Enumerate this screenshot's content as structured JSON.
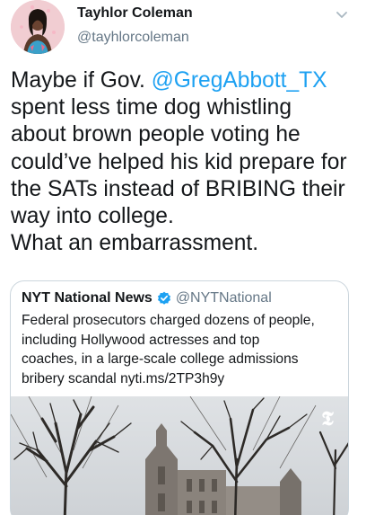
{
  "author": {
    "name": "Tayhlor Coleman",
    "handle": "@tayhlorcoleman"
  },
  "tweet": {
    "lines": [
      {
        "pre": "Maybe if Gov. ",
        "mention": "@GregAbbott_TX",
        "post": ""
      },
      {
        "text": "spent less time dog whistling"
      },
      {
        "text": "about brown people voting he"
      },
      {
        "text": "could’ve helped his kid prepare for"
      },
      {
        "text": "the SATs instead of BRIBING their"
      },
      {
        "text": "way into college."
      },
      {
        "text": "What an embarrassment."
      }
    ]
  },
  "quote": {
    "name": "NYT National News",
    "handle": "@NYTNational",
    "lines": [
      "Federal prosecutors charged dozens of people,",
      "including Hollywood actresses and top",
      "coaches, in a large-scale college admissions",
      "bribery scandal nyti.ms/2TP3h9y"
    ],
    "image_logo": "𝕿"
  },
  "colors": {
    "link": "#1da1f2",
    "text": "#14171a",
    "secondary": "#657786",
    "border": "#ccd6dd"
  },
  "icons": {
    "menu": "chevron-down-icon",
    "verified": "verified-badge-icon"
  }
}
